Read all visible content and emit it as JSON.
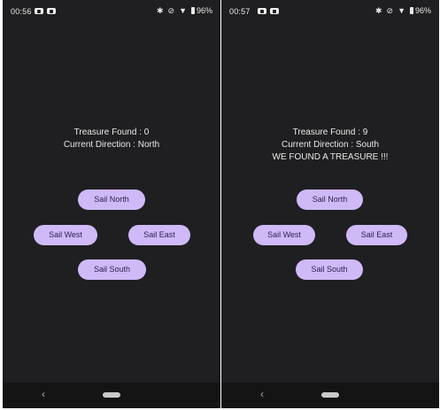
{
  "screens": [
    {
      "status": {
        "time": "00:56",
        "battery": "96%"
      },
      "treasure_text": "Treasure Found : 0",
      "direction_text": "Current Direction : North",
      "message": "",
      "buttons": {
        "north": "Sail North",
        "west": "Sail West",
        "east": "Sail East",
        "south": "Sail South"
      }
    },
    {
      "status": {
        "time": "00:57",
        "battery": "96%"
      },
      "treasure_text": "Treasure Found : 9",
      "direction_text": "Current Direction : South",
      "message": "WE FOUND A TREASURE !!!",
      "buttons": {
        "north": "Sail North",
        "west": "Sail West",
        "east": "Sail East",
        "south": "Sail South"
      }
    }
  ],
  "icons": {
    "status_notifications": "youtube-notification-icon",
    "status_right": [
      "bluetooth-icon",
      "mute-icon",
      "wifi-icon",
      "battery-icon"
    ],
    "nav": [
      "back-icon",
      "home-pill-icon"
    ]
  },
  "colors": {
    "screen_background": "#1f1f21",
    "button_background": "#cfbaf7",
    "button_text": "#2a1f4e",
    "text": "#e9e9e9",
    "nav_bar": "#141414"
  }
}
